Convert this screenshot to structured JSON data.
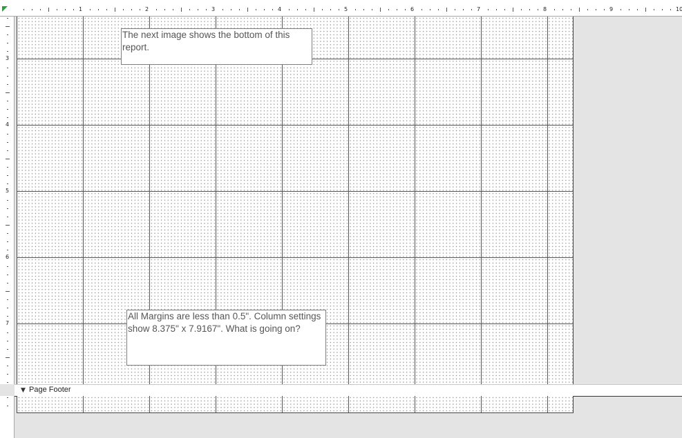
{
  "ruler": {
    "horizontal_numbers": [
      "1",
      "2",
      "3",
      "4",
      "5",
      "6",
      "7",
      "8",
      "9",
      "10"
    ],
    "vertical_numbers": [
      "3",
      "4",
      "5",
      "6",
      "7"
    ]
  },
  "sections": {
    "page_footer_label": "Page Footer"
  },
  "textboxes": {
    "box1": "The next image shows the bottom of this report.",
    "box2": "All Margins are less than 0.5\". Column settings show 8.375\" x 7.9167\".  What is going on?"
  },
  "icons": {
    "section_collapse": "arrow-down-icon"
  },
  "colors": {
    "corner_marker": "#21a336",
    "background": "#e4e4e4"
  }
}
